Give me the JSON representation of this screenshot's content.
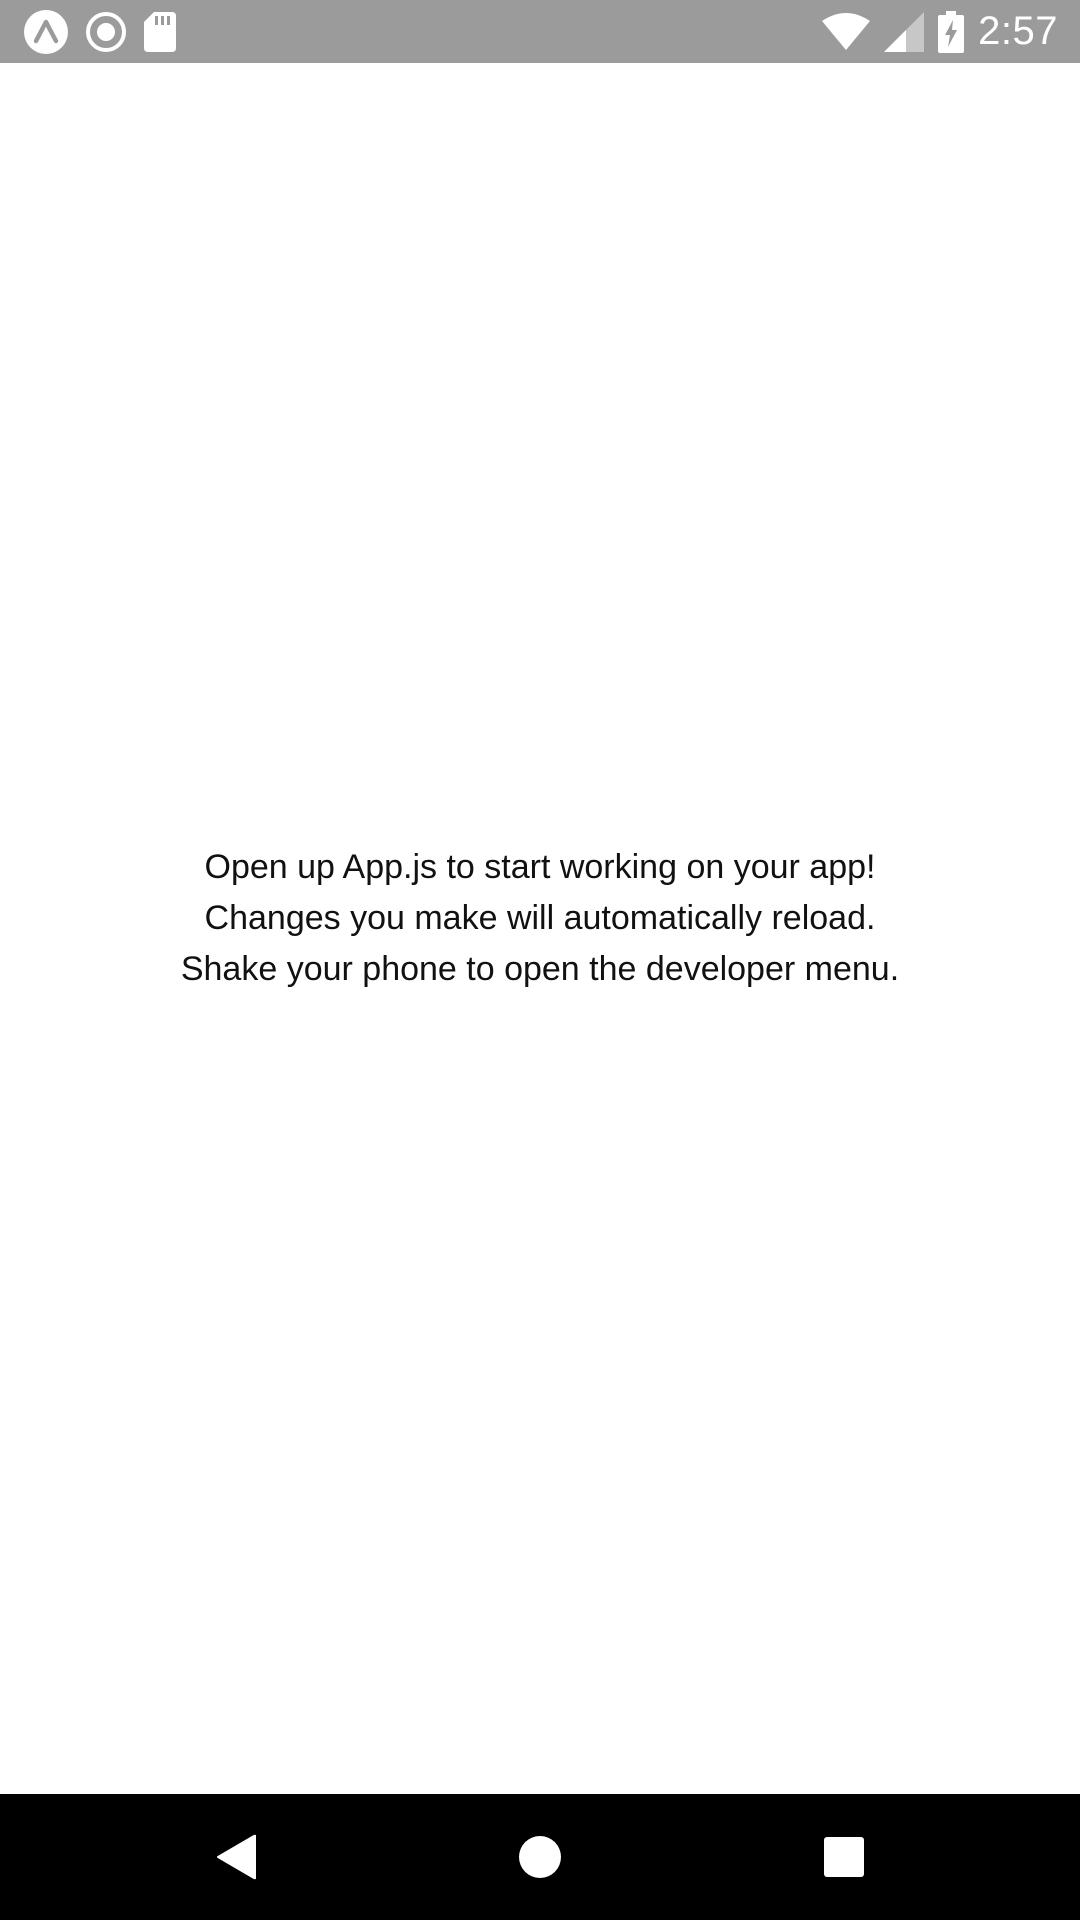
{
  "status_bar": {
    "time": "2:57",
    "icons_left": [
      "expo-icon",
      "record-icon",
      "sd-card-icon"
    ],
    "icons_right": [
      "wifi-icon",
      "cell-signal-icon",
      "battery-charging-icon"
    ],
    "background": "#9b9b9b"
  },
  "main": {
    "lines": [
      "Open up App.js to start working on your app!",
      "Changes you make will automatically reload.",
      "Shake your phone to open the developer menu."
    ]
  },
  "nav_bar": {
    "buttons": [
      "back-icon",
      "home-icon",
      "recents-icon"
    ],
    "background": "#000000"
  }
}
